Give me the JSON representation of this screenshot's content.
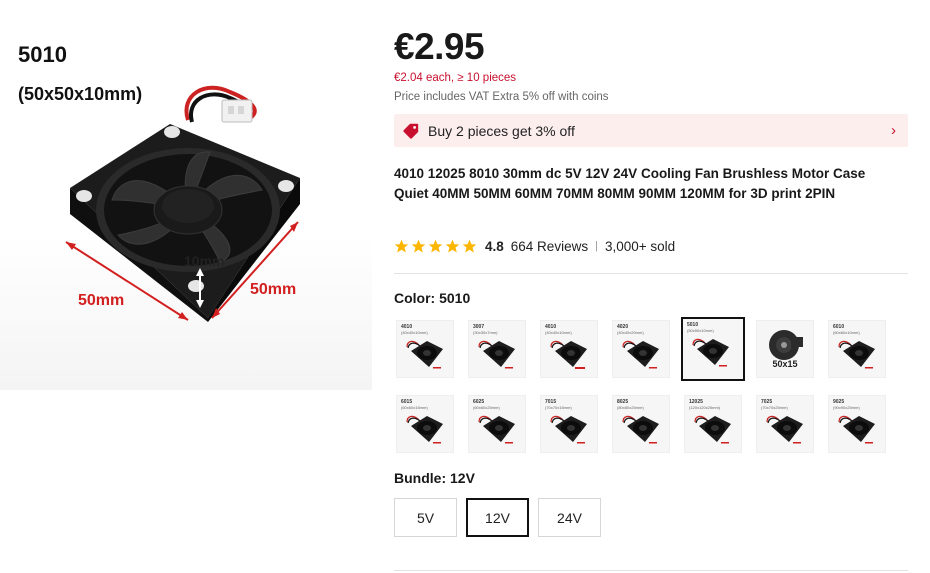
{
  "hero": {
    "size_code": "5010",
    "size_dims": "(50x50x10mm)",
    "dim_height": "10mm",
    "dim_width_a": "50mm",
    "dim_width_b": "50mm"
  },
  "price": {
    "main": "€2.95",
    "bulk": "€2.04 each, ≥ 10 pieces",
    "vat_note": "Price includes VAT Extra 5% off with coins"
  },
  "promo": {
    "text": "Buy 2 pieces get 3% off",
    "icon": "tag-icon",
    "chevron": "›"
  },
  "product": {
    "title": "4010 12025 8010 30mm dc 5V 12V 24V Cooling Fan Brushless Motor Case Quiet 40MM 50MM 60MM 70MM 80MM 90MM 120MM for 3D print 2PIN"
  },
  "rating": {
    "stars": 5,
    "score": "4.8",
    "reviews": "664 Reviews",
    "separator": "|",
    "sold": "3,000+ sold"
  },
  "colors": {
    "accent": "#c8102e",
    "star": "#fdb600",
    "promo_bg": "#fdeeee"
  },
  "color_option": {
    "label": "Color: 5010",
    "selected_index": 4,
    "swatches": [
      {
        "cap": "4010",
        "sub": "(40x40x10mm)",
        "big": "",
        "kind": "fan-wire"
      },
      {
        "cap": "3007",
        "sub": "(30x30x7mm)",
        "big": "",
        "kind": "fan-wire"
      },
      {
        "cap": "4010",
        "sub": "(40x40x10mm)",
        "big": "",
        "kind": "fan-red"
      },
      {
        "cap": "4020",
        "sub": "(40x40x20mm)",
        "big": "",
        "kind": "fan-wire"
      },
      {
        "cap": "5010",
        "sub": "(50x50x10mm)",
        "big": "",
        "kind": "fan-wire"
      },
      {
        "cap": "",
        "sub": "",
        "big": "50x15",
        "kind": "blower"
      },
      {
        "cap": "6010",
        "sub": "(60x60x10mm)",
        "big": "",
        "kind": "fan-wire"
      },
      {
        "cap": "6015",
        "sub": "(60x60x15mm)",
        "big": "",
        "kind": "fan-wire"
      },
      {
        "cap": "6025",
        "sub": "(60x60x25mm)",
        "big": "",
        "kind": "fan-wire"
      },
      {
        "cap": "7015",
        "sub": "(70x70x15mm)",
        "big": "",
        "kind": "fan-wire"
      },
      {
        "cap": "8025",
        "sub": "(80x80x25mm)",
        "big": "",
        "kind": "fan-wire"
      },
      {
        "cap": "12025",
        "sub": "(120x120x25mm)",
        "big": "",
        "kind": "fan-wire"
      },
      {
        "cap": "7025",
        "sub": "(70x70x25mm)",
        "big": "",
        "kind": "fan-wire"
      },
      {
        "cap": "9025",
        "sub": "(90x90x25mm)",
        "big": "",
        "kind": "fan-wire"
      }
    ]
  },
  "bundle": {
    "label": "Bundle: 12V",
    "options": [
      "5V",
      "12V",
      "24V"
    ],
    "selected_index": 1
  }
}
